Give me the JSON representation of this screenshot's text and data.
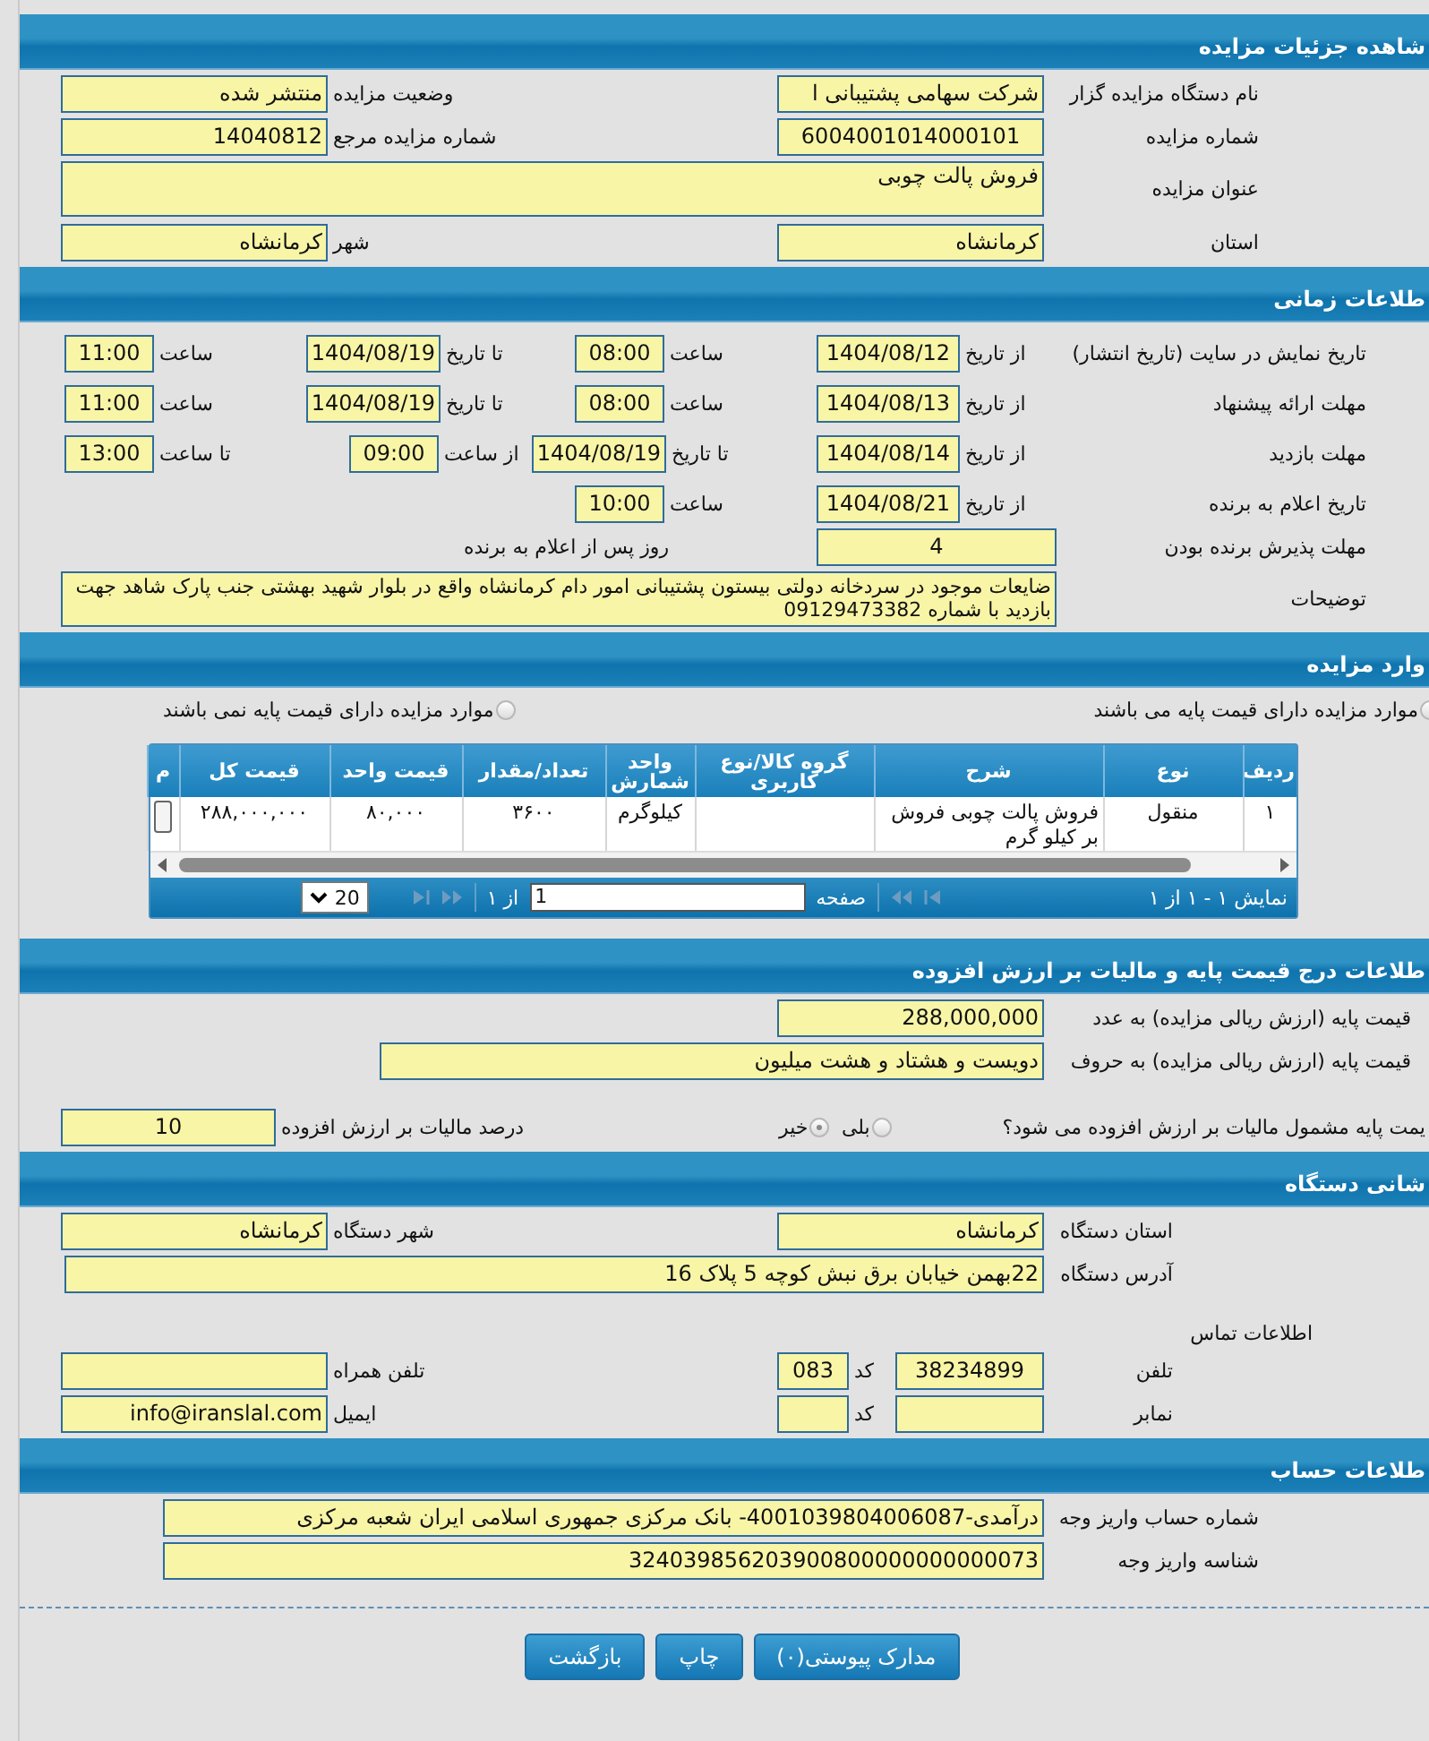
{
  "sections": [
    {
      "kind": "form",
      "title": "شاهده جزئیات مزایده",
      "rows": [
        [
          {
            "kind": "label",
            "text": "نام دستگاه مزایده گزار"
          },
          {
            "kind": "field",
            "value": "شرکت سهامی پشتیبانی ا"
          },
          {
            "kind": "label",
            "text": "وضعیت مزایده"
          },
          {
            "kind": "field",
            "value": "منتشر شده"
          }
        ],
        [
          {
            "kind": "label",
            "text": "شماره مزایده"
          },
          {
            "kind": "field",
            "value": "6004001014000101"
          },
          {
            "kind": "label",
            "text": "شماره مزایده مرجع"
          },
          {
            "kind": "field",
            "value": "14040812"
          }
        ],
        [
          {
            "kind": "label",
            "text": "عنوان مزایده"
          },
          {
            "kind": "area",
            "value": "فروش پالت چوبی"
          }
        ],
        [
          {
            "kind": "label",
            "text": "استان"
          },
          {
            "kind": "field",
            "value": "کرمانشاه"
          },
          {
            "kind": "label",
            "text": "شهر"
          },
          {
            "kind": "field",
            "value": "کرمانشاه"
          }
        ]
      ]
    },
    {
      "kind": "form",
      "title": "طلاعات زمانی",
      "rows": [
        [
          {
            "kind": "label",
            "text": "تاریخ نمایش در سایت (تاریخ انتشار)"
          },
          {
            "kind": "label",
            "text": "از تاریخ"
          },
          {
            "kind": "field",
            "value": "1404/08/12"
          },
          {
            "kind": "label",
            "text": "ساعت"
          },
          {
            "kind": "field",
            "value": "08:00"
          },
          {
            "kind": "label",
            "text": "تا تاریخ"
          },
          {
            "kind": "field",
            "value": "1404/08/19"
          },
          {
            "kind": "label",
            "text": "ساعت"
          },
          {
            "kind": "field",
            "value": "11:00"
          }
        ],
        [
          {
            "kind": "label",
            "text": "مهلت ارائه پیشنهاد"
          },
          {
            "kind": "label",
            "text": "از تاریخ"
          },
          {
            "kind": "field",
            "value": "1404/08/13"
          },
          {
            "kind": "label",
            "text": "ساعت"
          },
          {
            "kind": "field",
            "value": "08:00"
          },
          {
            "kind": "label",
            "text": "تا تاریخ"
          },
          {
            "kind": "field",
            "value": "1404/08/19"
          },
          {
            "kind": "label",
            "text": "ساعت"
          },
          {
            "kind": "field",
            "value": "11:00"
          }
        ],
        [
          {
            "kind": "label",
            "text": "مهلت بازدید"
          },
          {
            "kind": "label",
            "text": "از تاریخ"
          },
          {
            "kind": "field",
            "value": "1404/08/14"
          },
          {
            "kind": "label",
            "text": "تا تاریخ"
          },
          {
            "kind": "field",
            "value": "1404/08/19"
          },
          {
            "kind": "label",
            "text": "از ساعت"
          },
          {
            "kind": "field",
            "value": "09:00"
          },
          {
            "kind": "label",
            "text": "تا ساعت"
          },
          {
            "kind": "field",
            "value": "13:00"
          }
        ],
        [
          {
            "kind": "label",
            "text": "تاریخ اعلام به برنده"
          },
          {
            "kind": "label",
            "text": "از تاریخ"
          },
          {
            "kind": "field",
            "value": "1404/08/21"
          },
          {
            "kind": "label",
            "text": "ساعت"
          },
          {
            "kind": "field",
            "value": "10:00"
          }
        ],
        [
          {
            "kind": "label",
            "text": "مهلت پذیرش برنده بودن"
          },
          {
            "kind": "field",
            "value": "4",
            "suffix": "روز پس از اعلام به برنده"
          }
        ],
        [
          {
            "kind": "label",
            "text": "توضیحات"
          },
          {
            "kind": "area",
            "value": "ضایعات  موجود در  سردخانه دولتی بیستون  پشتیبانی امور دام کرمانشاه  واقع در  بلوار شهید بهشتی  جنب پارک شاهد جهت بازدید با شماره   09129473382"
          }
        ]
      ]
    },
    {
      "kind": "items",
      "title": "وارد مزایده",
      "options": [
        {
          "label": "موارد مزایده دارای قیمت پایه می باشند",
          "selected": false
        },
        {
          "label": "موارد مزایده دارای قیمت پایه نمی باشند",
          "selected": false
        }
      ],
      "table": {
        "columns": [
          "ردیف",
          "نوع",
          "شرح",
          "گروه کالا/نوع کاربری",
          "واحد شمارش",
          "تعداد/مقدار",
          "قیمت واحد",
          "قیمت کل",
          "م"
        ],
        "rows": [
          [
            "۱",
            "منقول",
            "فروش پالت چوبی  فروش بر کیلو گرم",
            null,
            "کیلوگرم",
            "۳۶۰۰",
            "۸۰,۰۰۰",
            "۲۸۸,۰۰۰,۰۰۰",
            null
          ]
        ]
      },
      "pager": {
        "summary": "نمایش ۱ - ۱ از ۱",
        "page_label": "صفحه",
        "page": "1",
        "page_count": "از ۱",
        "page_size": "20"
      }
    },
    {
      "kind": "form",
      "title": "طلاعات درج قیمت پایه و مالیات بر ارزش افزوده",
      "rows": [
        [
          {
            "kind": "label",
            "text": "قیمت پایه (ارزش ریالی مزایده) به عدد"
          },
          {
            "kind": "field",
            "value": "288,000,000"
          }
        ],
        [
          {
            "kind": "label",
            "text": "قیمت پایه (ارزش ریالی مزایده) به حروف"
          },
          {
            "kind": "field",
            "value": "دویست و هشتاد و هشت میلیون"
          }
        ],
        [
          {
            "kind": "label",
            "text": "یمت پایه مشمول مالیات بر ارزش افزوده می شود؟"
          },
          {
            "kind": "radio",
            "label": "بلی",
            "selected": false
          },
          {
            "kind": "radio",
            "label": "خیر",
            "selected": true
          },
          {
            "kind": "label",
            "text": "درصد مالیات بر ارزش افزوده"
          },
          {
            "kind": "field",
            "value": "10"
          }
        ]
      ]
    },
    {
      "kind": "form",
      "title": "شانی دستگاه",
      "rows": [
        [
          {
            "kind": "field",
            "label": "استان دستگاه",
            "value": "کرمانشاه"
          },
          {
            "kind": "field",
            "label": "شهر دستگاه",
            "value": "کرمانشاه"
          }
        ],
        [
          {
            "kind": "label",
            "text": "آدرس دستگاه"
          },
          {
            "kind": "field",
            "value": "22بهمن  خیابان  برق نبش کوچه 5 پلاک 16"
          }
        ],
        [
          {
            "kind": "note",
            "text": "اطلاعات تماس"
          }
        ],
        [
          {
            "kind": "phone",
            "label": "تلفن",
            "value": "38234899",
            "code_label": "کد",
            "code": "083"
          },
          {
            "kind": "field",
            "label": "تلفن همراه"
          }
        ],
        [
          {
            "kind": "phone",
            "label": "نمابر",
            "code_label": "کد"
          },
          {
            "kind": "field",
            "label": "ایمیل",
            "value": "info@iranslal.com"
          }
        ]
      ]
    },
    {
      "kind": "form",
      "title": "طلاعات حساب",
      "rows": [
        [
          {
            "kind": "label",
            "text": "شماره حساب واریز وجه"
          },
          {
            "kind": "field",
            "value": "درآمدی-4001039804006087- بانک مرکزی جمهوری اسلامی ایران شعبه مرکزی"
          }
        ],
        [
          {
            "kind": "label",
            "text": "شناسه واریز وجه"
          },
          {
            "kind": "field",
            "value": "324039856203900800000000000073"
          }
        ]
      ]
    }
  ],
  "buttons": [
    "مدارک پیوستی(۰)",
    "چاپ",
    "بازگشت"
  ]
}
